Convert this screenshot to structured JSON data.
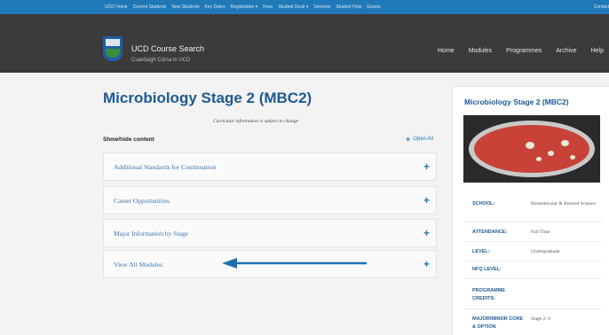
{
  "top_nav": {
    "items": [
      "UCD Home",
      "Current Students",
      "New Students",
      "Key Dates",
      "Registration ▾",
      "Fees",
      "Student Desk ▾",
      "Services",
      "Student Help",
      "Exams"
    ],
    "right_link": "Contact"
  },
  "header": {
    "site_title": "UCD Course Search",
    "site_subtitle": "Cuardaigh Cúrsa in UCD",
    "nav": [
      "Home",
      "Modules",
      "Programmes",
      "Archive",
      "Help"
    ]
  },
  "main": {
    "title": "Microbiology Stage 2 (MBC2)",
    "notice": "Curricular information is subject to change",
    "show_hide": "Show/hide content",
    "open_all": "Open All",
    "accordion": [
      {
        "label": "Additional Standards for Continuation"
      },
      {
        "label": "Career Opportunities"
      },
      {
        "label": "Major Information by Stage"
      },
      {
        "label": "View All Modules"
      }
    ]
  },
  "sidebar": {
    "title": "Microbiology Stage 2 (MBC2)",
    "info": [
      {
        "key": "SCHOOL:",
        "value": "Biomolecular & Biomed Science"
      },
      {
        "key": "ATTENDANCE:",
        "value": "Full Time"
      },
      {
        "key": "LEVEL:",
        "value": "Undergraduate"
      },
      {
        "key": "NFQ LEVEL:",
        "value": ""
      },
      {
        "key": "PROGRAMME CREDITS:",
        "value": ""
      },
      {
        "key": "MAJOR/MINOR CORE & OPTION",
        "value": "Stage 2: 0"
      }
    ]
  },
  "colors": {
    "top_bar": "#1f78b7",
    "header": "#3b3b3b",
    "title_blue": "#1d5a93",
    "accent": "#1f78b7"
  },
  "icons": [
    "plus-icon",
    "arrow-icon",
    "ucd-logo-icon"
  ]
}
